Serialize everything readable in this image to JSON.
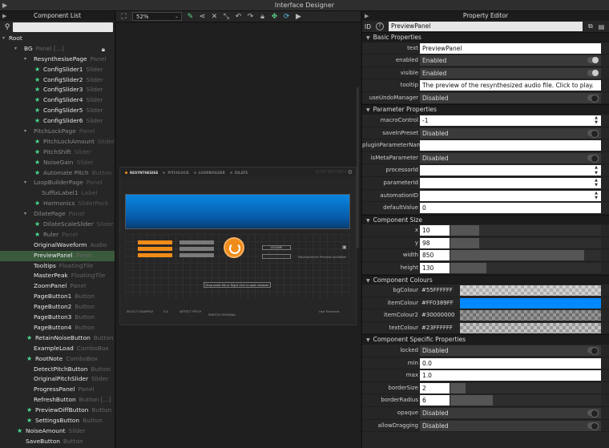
{
  "window": {
    "title": "Interface Designer"
  },
  "left_panel": {
    "title": "Component List",
    "tree": [
      {
        "name": "Root",
        "type": "",
        "indent": 0,
        "twisty": true,
        "star": false,
        "dim": false
      },
      {
        "name": "BG",
        "type": "Panel [...]",
        "indent": 1,
        "twisty": true,
        "star": false,
        "dim": false,
        "lock": true
      },
      {
        "name": "ResynthesisePage",
        "type": "Panel",
        "indent": 2,
        "twisty": true,
        "star": false,
        "dim": false
      },
      {
        "name": "ConfigSlider1",
        "type": "Slider",
        "indent": 3,
        "twisty": false,
        "star": true,
        "dim": false
      },
      {
        "name": "ConfigSlider2",
        "type": "Slider",
        "indent": 3,
        "twisty": false,
        "star": true,
        "dim": false
      },
      {
        "name": "ConfigSlider3",
        "type": "Slider",
        "indent": 3,
        "twisty": false,
        "star": true,
        "dim": false
      },
      {
        "name": "ConfigSlider4",
        "type": "Slider",
        "indent": 3,
        "twisty": false,
        "star": true,
        "dim": false
      },
      {
        "name": "ConfigSlider5",
        "type": "Slider",
        "indent": 3,
        "twisty": false,
        "star": true,
        "dim": false
      },
      {
        "name": "ConfigSlider6",
        "type": "Slider",
        "indent": 3,
        "twisty": false,
        "star": true,
        "dim": false
      },
      {
        "name": "PitchLockPage",
        "type": "Panel",
        "indent": 2,
        "twisty": true,
        "star": false,
        "dim": true
      },
      {
        "name": "PitchLockAmount",
        "type": "Slider",
        "indent": 3,
        "twisty": false,
        "star": true,
        "dim": true
      },
      {
        "name": "PitchShift",
        "type": "Slider",
        "indent": 3,
        "twisty": false,
        "star": true,
        "dim": true
      },
      {
        "name": "NoiseGain",
        "type": "Slider",
        "indent": 3,
        "twisty": false,
        "star": true,
        "dim": true
      },
      {
        "name": "Automate Pitch",
        "type": "Button",
        "indent": 3,
        "twisty": false,
        "star": true,
        "dim": true
      },
      {
        "name": "LoopBuilderPage",
        "type": "Panel",
        "indent": 2,
        "twisty": true,
        "star": false,
        "dim": true
      },
      {
        "name": "SuffixLabel1",
        "type": "Label",
        "indent": 3,
        "twisty": false,
        "star": false,
        "dim": true
      },
      {
        "name": "Harmonics",
        "type": "SliderPack",
        "indent": 3,
        "twisty": false,
        "star": true,
        "dim": true
      },
      {
        "name": "DilatePage",
        "type": "Panel",
        "indent": 2,
        "twisty": true,
        "star": false,
        "dim": true
      },
      {
        "name": "DilateScaleSlider",
        "type": "Slider",
        "indent": 3,
        "twisty": false,
        "star": true,
        "dim": true
      },
      {
        "name": "Ruler",
        "type": "Panel",
        "indent": 3,
        "twisty": false,
        "star": true,
        "dim": true
      },
      {
        "name": "OriginalWaveform",
        "type": "Audio",
        "indent": 2,
        "twisty": false,
        "star": false,
        "dim": false
      },
      {
        "name": "PreviewPanel",
        "type": "Panel",
        "indent": 2,
        "twisty": false,
        "star": false,
        "dim": false,
        "selected": true
      },
      {
        "name": "Tooltips",
        "type": "FloatingTile",
        "indent": 2,
        "twisty": false,
        "star": false,
        "dim": false
      },
      {
        "name": "MasterPeak",
        "type": "FloatingTile",
        "indent": 2,
        "twisty": false,
        "star": false,
        "dim": false
      },
      {
        "name": "ZoomPanel",
        "type": "Panel",
        "indent": 2,
        "twisty": false,
        "star": false,
        "dim": false
      },
      {
        "name": "PageButton1",
        "type": "Button",
        "indent": 2,
        "twisty": false,
        "star": false,
        "dim": false
      },
      {
        "name": "PageButton2",
        "type": "Button",
        "indent": 2,
        "twisty": false,
        "star": false,
        "dim": false
      },
      {
        "name": "PageButton3",
        "type": "Button",
        "indent": 2,
        "twisty": false,
        "star": false,
        "dim": false
      },
      {
        "name": "PageButton4",
        "type": "Button",
        "indent": 2,
        "twisty": false,
        "star": false,
        "dim": false
      },
      {
        "name": "RetainNoiseButton",
        "type": "Button",
        "indent": 2,
        "twisty": false,
        "star": true,
        "dim": false
      },
      {
        "name": "ExampleLoad",
        "type": "ComboBox",
        "indent": 2,
        "twisty": false,
        "star": false,
        "dim": false
      },
      {
        "name": "RootNote",
        "type": "ComboBox",
        "indent": 2,
        "twisty": false,
        "star": true,
        "dim": false
      },
      {
        "name": "DetectPitchButton",
        "type": "Button",
        "indent": 2,
        "twisty": false,
        "star": false,
        "dim": false
      },
      {
        "name": "OriginalPitchSlider",
        "type": "Slider",
        "indent": 2,
        "twisty": false,
        "star": false,
        "dim": false
      },
      {
        "name": "ProgressPanel",
        "type": "Panel",
        "indent": 2,
        "twisty": false,
        "star": false,
        "dim": false
      },
      {
        "name": "RefreshButton",
        "type": "Button [...]",
        "indent": 2,
        "twisty": false,
        "star": false,
        "dim": false
      },
      {
        "name": "PreviewDiffButton",
        "type": "Button",
        "indent": 2,
        "twisty": false,
        "star": true,
        "dim": false
      },
      {
        "name": "SettingsButton",
        "type": "Button",
        "indent": 2,
        "twisty": false,
        "star": true,
        "dim": false
      },
      {
        "name": "NoiseAmount",
        "type": "Slider",
        "indent": 1,
        "twisty": false,
        "star": true,
        "dim": false
      },
      {
        "name": "SaveButton",
        "type": "Button",
        "indent": 1,
        "twisty": false,
        "star": false,
        "dim": false
      }
    ]
  },
  "toolbar": {
    "zoom": "52%"
  },
  "preview": {
    "tabs": [
      "RESYNTHESISE",
      "PITCHLOCK",
      "LOOPBUILDER",
      "DILATE"
    ],
    "brand": "LOOP RESYNTH",
    "drop_text": "Drop audio file or Right click to open browser",
    "volume_label": "VOLUME",
    "dev_text": "Development Preview available",
    "bottom_left": "SELECT EXAMPLE",
    "bottom_val": "0.0",
    "bottom_mid": "DETECT PITCH",
    "bottom_mid2": "SWITCH ORIGINAL",
    "bottom_right": "Use Transient"
  },
  "right_panel": {
    "title": "Property Editor",
    "id_label": "ID",
    "id_value": "PreviewPanel",
    "sections": {
      "basic": "Basic Properties",
      "parameter": "Parameter Properties",
      "size": "Component Size",
      "colours": "Component Colours",
      "specific": "Component Specific Properties"
    },
    "basic": {
      "text": {
        "label": "text",
        "value": "PreviewPanel"
      },
      "enabled": {
        "label": "enabled",
        "value": "Enabled"
      },
      "visible": {
        "label": "visible",
        "value": "Enabled"
      },
      "tooltip": {
        "label": "tooltip",
        "value": "The preview of the resynthesized audio file. Click to play."
      },
      "useUndoManager": {
        "label": "useUndoManager",
        "value": "Disabled"
      }
    },
    "parameter": {
      "macroControl": {
        "label": "macroControl",
        "value": "-1"
      },
      "saveInPreset": {
        "label": "saveInPreset",
        "value": "Disabled"
      },
      "pluginParameterName": {
        "label": "pluginParameterName",
        "value": ""
      },
      "isMetaParameter": {
        "label": "isMetaParameter",
        "value": "Disabled"
      },
      "processorId": {
        "label": "processorId",
        "value": ""
      },
      "parameterId": {
        "label": "parameterId",
        "value": ""
      },
      "automationID": {
        "label": "automationID",
        "value": ""
      },
      "defaultValue": {
        "label": "defaultValue",
        "value": "0"
      }
    },
    "size": {
      "x": {
        "label": "x",
        "value": "10",
        "fill": 0.19
      },
      "y": {
        "label": "y",
        "value": "98",
        "fill": 0.19
      },
      "width": {
        "label": "width",
        "value": "850",
        "fill": 0.89
      },
      "height": {
        "label": "height",
        "value": "130",
        "fill": 0.24
      }
    },
    "colours": {
      "bgColour": {
        "label": "bgColour",
        "value": "#55FFFFFF",
        "color": "rgba(255,255,255,0.33)"
      },
      "itemColour": {
        "label": "itemColour",
        "value": "#FF0389FF",
        "color": "#0389FF"
      },
      "itemColour2": {
        "label": "itemColour2",
        "value": "#30000000",
        "color": "rgba(0,0,0,0.19)"
      },
      "textColour": {
        "label": "textColour",
        "value": "#23FFFFFF",
        "color": "rgba(255,255,255,0.14)"
      }
    },
    "specific": {
      "locked": {
        "label": "locked",
        "value": "Disabled"
      },
      "min": {
        "label": "min",
        "value": "0.0"
      },
      "max": {
        "label": "max",
        "value": "1.0"
      },
      "borderSize": {
        "label": "borderSize",
        "value": "2",
        "fill": 0.1
      },
      "borderRadius": {
        "label": "borderRadius",
        "value": "6",
        "fill": 0.28
      },
      "opaque": {
        "label": "opaque",
        "value": "Disabled"
      },
      "allowDragging": {
        "label": "allowDragging",
        "value": "Disabled"
      }
    }
  },
  "colors": {
    "accent_orange": "#F08C19",
    "star_green": "#4ADE8F",
    "wave_blue": "#0A86E0",
    "selection": "#3A5A3C"
  }
}
